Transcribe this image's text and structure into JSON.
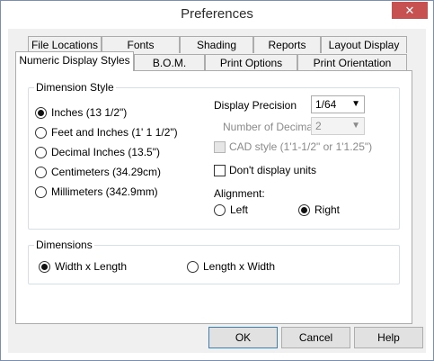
{
  "window": {
    "title": "Preferences",
    "close_glyph": "✕"
  },
  "tabs_back": [
    "File Locations",
    "Fonts",
    "Shading",
    "Reports",
    "Layout Display"
  ],
  "tabs_front": [
    "Numeric Display Styles",
    "B.O.M.",
    "Print Options",
    "Print Orientation"
  ],
  "active_tab": "Numeric Display Styles",
  "dimension_style": {
    "label": "Dimension Style",
    "options": [
      "Inches (13 1/2\")",
      "Feet and Inches (1' 1 1/2\")",
      "Decimal Inches (13.5\")",
      "Centimeters (34.29cm)",
      "Millimeters (342.9mm)"
    ],
    "selected": "Inches (13 1/2\")"
  },
  "display_precision": {
    "label": "Display Precision",
    "value": "1/64"
  },
  "number_of_decimals": {
    "label": "Number of Decimals",
    "value": "2",
    "disabled": true
  },
  "cad_style": {
    "label": "CAD style (1'1-1/2\" or 1'1.25\")",
    "checked": false,
    "disabled": true
  },
  "dont_display_units": {
    "label": "Don't display units",
    "checked": false
  },
  "alignment": {
    "label": "Alignment:",
    "left": "Left",
    "right": "Right",
    "selected": "Right"
  },
  "dimensions": {
    "label": "Dimensions",
    "option1": "Width x Length",
    "option2": "Length x Width",
    "selected": "Width x Length"
  },
  "buttons": {
    "ok": "OK",
    "cancel": "Cancel",
    "help": "Help"
  },
  "colors": {
    "close_button": "#c75050",
    "default_button_border": "#3c7fb1"
  }
}
